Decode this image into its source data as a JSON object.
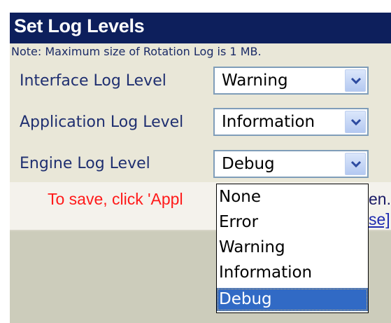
{
  "header": {
    "title": "Set Log Levels"
  },
  "note": "Note: Maximum size of Rotation Log is 1 MB.",
  "rows": [
    {
      "label": "Interface Log Level",
      "value": "Warning"
    },
    {
      "label": "Application Log Level",
      "value": "Information"
    },
    {
      "label": "Engine Log Level",
      "value": "Debug"
    }
  ],
  "dropdown": {
    "options": [
      "None",
      "Error",
      "Warning",
      "Information",
      "Debug"
    ],
    "selected": "Debug"
  },
  "save_hint": {
    "visible_start": "To save, click 'Appl",
    "visible_end": "en.",
    "link_visible_end": "se]"
  },
  "icons": {
    "select_arrow": "chevron-down-icon"
  },
  "colors": {
    "title_bg": "#0d1f5c",
    "hint_text": "#ff1a1a",
    "selection": "#316ac5"
  }
}
